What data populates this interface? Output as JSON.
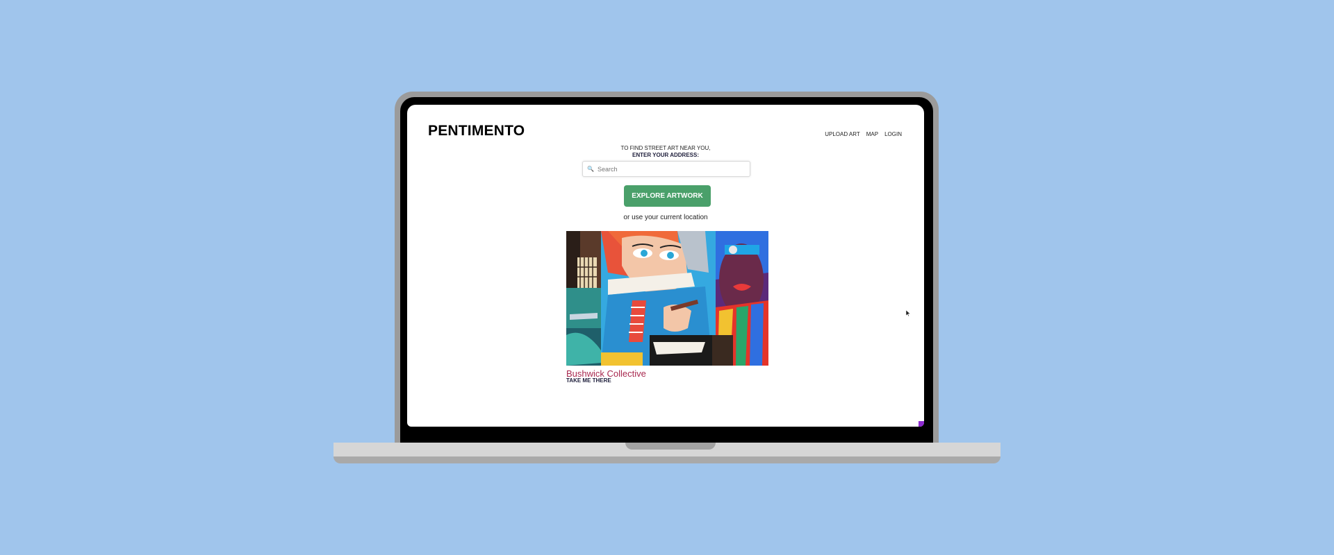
{
  "app": {
    "logo": "PENTIMENTO"
  },
  "nav": {
    "items": [
      "UPLOAD ART",
      "MAP",
      "LOGIN"
    ]
  },
  "prompt": {
    "line1": "TO FIND STREET ART NEAR YOU,",
    "line2": "ENTER YOUR ADDRESS:"
  },
  "search": {
    "placeholder": "Search",
    "value": "",
    "icon": "search-icon"
  },
  "explore_button": {
    "label": "EXPLORE ARTWORK"
  },
  "location_link": {
    "label": "or use your current location"
  },
  "featured": {
    "title": "Bushwick Collective",
    "cta": "TAKE ME THERE"
  },
  "colors": {
    "background": "#a0c5ec",
    "button": "#4aa06a",
    "title_accent": "#a8294f",
    "dark_text": "#1d1d3a"
  }
}
